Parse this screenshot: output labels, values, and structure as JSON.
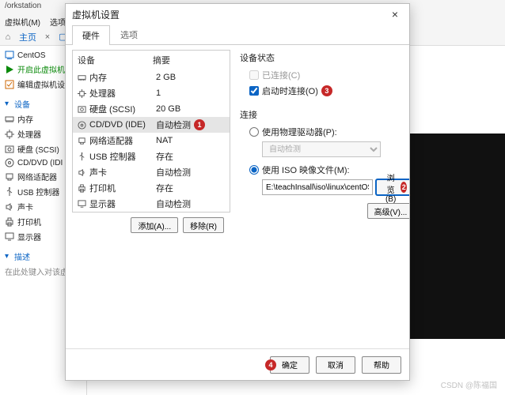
{
  "window": {
    "title": "/orkstation"
  },
  "menubar": {
    "vm": "虚拟机(M)",
    "tabs": "选项卡(T)"
  },
  "tabbar": {
    "home": "主页",
    "tab1": "c"
  },
  "tree": {
    "vm_name": "CentOS",
    "start": "开启此虚拟机",
    "edit": "编辑虚拟机设",
    "devices_group": "设备",
    "devices": [
      "内存",
      "处理器",
      "硬盘 (SCSI)",
      "CD/DVD (IDI",
      "网络适配器",
      "USB 控制器",
      "声卡",
      "打印机",
      "显示器"
    ],
    "desc_group": "描述",
    "desc_placeholder": "在此处键入对该虚"
  },
  "dialog": {
    "title": "虚拟机设置",
    "close": "×",
    "tabs": {
      "hardware": "硬件",
      "options": "选项"
    },
    "columns": {
      "device": "设备",
      "summary": "摘要"
    },
    "devices": [
      {
        "name": "内存",
        "summary": "2 GB",
        "icon": "memory"
      },
      {
        "name": "处理器",
        "summary": "1",
        "icon": "cpu"
      },
      {
        "name": "硬盘 (SCSI)",
        "summary": "20 GB",
        "icon": "disk"
      },
      {
        "name": "CD/DVD (IDE)",
        "summary": "自动检测",
        "icon": "cd",
        "selected": true,
        "badge": "1"
      },
      {
        "name": "网络适配器",
        "summary": "NAT",
        "icon": "net"
      },
      {
        "name": "USB 控制器",
        "summary": "存在",
        "icon": "usb"
      },
      {
        "name": "声卡",
        "summary": "自动检测",
        "icon": "sound"
      },
      {
        "name": "打印机",
        "summary": "存在",
        "icon": "printer"
      },
      {
        "name": "显示器",
        "summary": "自动检测",
        "icon": "display"
      }
    ],
    "add": "添加(A)...",
    "remove": "移除(R)",
    "status": {
      "title": "设备状态",
      "connected": "已连接(C)",
      "connect_at_poweron": "启动时连接(O)",
      "badge3": "3"
    },
    "connection": {
      "title": "连接",
      "use_physical": "使用物理驱动器(P):",
      "autodetect": "自动检测",
      "use_iso": "使用 ISO 映像文件(M):",
      "iso_path": "E:\\teachInsall\\iso\\linux\\centOS",
      "browse": "浏览(B)",
      "badge2": "2",
      "advanced": "高级(V)..."
    },
    "footer": {
      "ok": "确定",
      "cancel": "取消",
      "help": "帮助",
      "badge4": "4"
    }
  },
  "watermark": "CSDN @陈福国"
}
